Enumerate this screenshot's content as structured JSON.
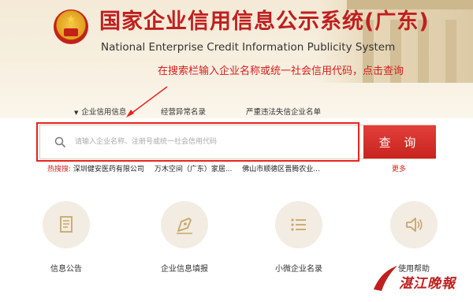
{
  "header": {
    "title_cn": "国家企业信用信息公示系统(广东)",
    "title_en": "National Enterprise Credit Information Publicity System",
    "hint": "在搜索栏输入企业名称或统一社会信用代码，点击查询"
  },
  "tabs": [
    {
      "label": "企业信用信息",
      "active": true
    },
    {
      "label": "经营异常名录"
    },
    {
      "label": "严重违法失信企业名单"
    }
  ],
  "search": {
    "placeholder": "请输入企业名称、注册号或统一社会信用代码",
    "button_label": "查 询"
  },
  "hot_search": {
    "label": "热搜搜:",
    "items": [
      "深圳健安医药有限公司",
      "万木空间（广东）家居...",
      "佛山市顺德区晋腾农业..."
    ],
    "more_label": "更多"
  },
  "cards": [
    {
      "label": "信息公告",
      "icon": "document-icon"
    },
    {
      "label": "企业信息填报",
      "icon": "pen-nib-icon"
    },
    {
      "label": "小微企业名录",
      "icon": "list-icon"
    },
    {
      "label": "使用帮助",
      "icon": "speaker-icon"
    }
  ],
  "watermark": {
    "text": "湛江晚報"
  },
  "colors": {
    "accent": "#c8231f",
    "title": "#c01f1f",
    "highlight": "#e8231f"
  }
}
